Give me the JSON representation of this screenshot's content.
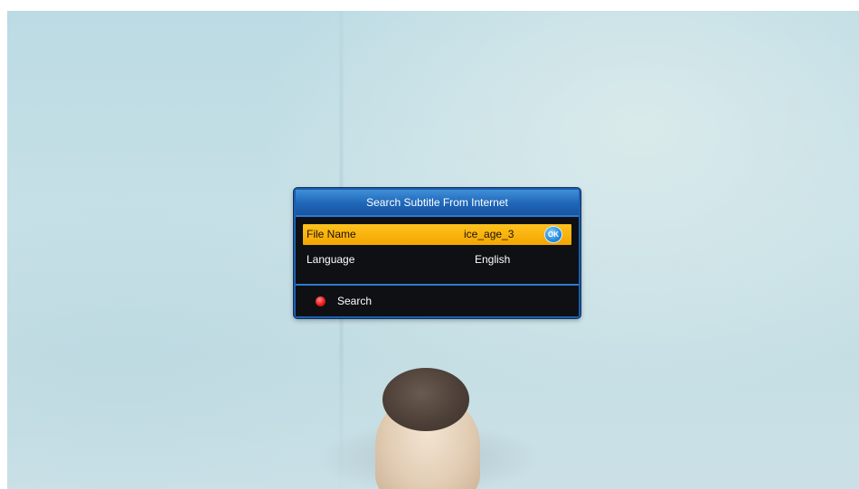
{
  "dialog": {
    "title": "Search Subtitle From Internet",
    "rows": [
      {
        "label": "File Name",
        "value": "ice_age_3",
        "selected": true,
        "action_icon": "ok-button-icon",
        "action_text": "OK"
      },
      {
        "label": "Language",
        "value": "English",
        "selected": false
      }
    ],
    "footer": {
      "key_icon": "red-key-icon",
      "action_label": "Search"
    }
  },
  "colors": {
    "dialog_border": "#1d5fae",
    "header_blue": "#1f66b8",
    "selection_yellow": "#f3a500",
    "dialog_background": "#0e1014",
    "red_key": "#ee1a1a"
  }
}
